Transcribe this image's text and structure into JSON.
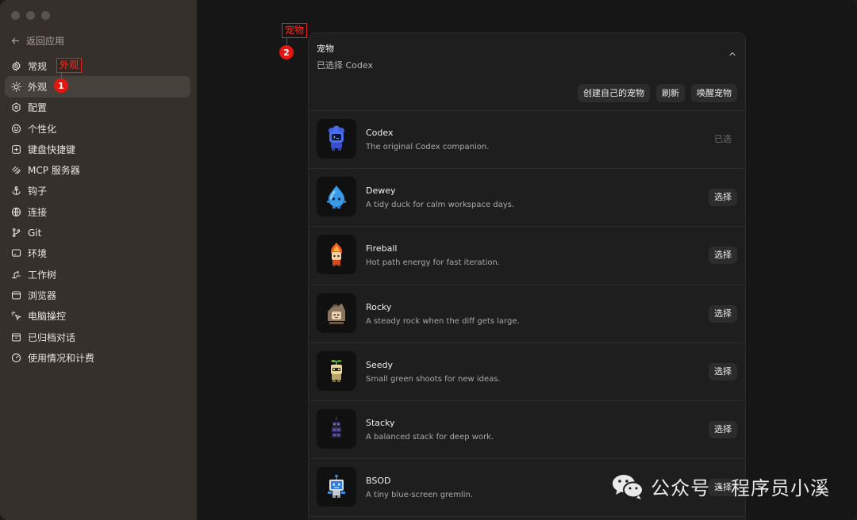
{
  "sidebar": {
    "back_label": "返回应用",
    "items": [
      {
        "label": "常规",
        "icon": "gear-icon"
      },
      {
        "label": "外观",
        "icon": "sun-icon",
        "active": true
      },
      {
        "label": "配置",
        "icon": "config-icon"
      },
      {
        "label": "个性化",
        "icon": "smile-icon"
      },
      {
        "label": "键盘快捷键",
        "icon": "keyboard-icon"
      },
      {
        "label": "MCP 服务器",
        "icon": "mcp-icon"
      },
      {
        "label": "钩子",
        "icon": "anchor-icon"
      },
      {
        "label": "连接",
        "icon": "globe-icon"
      },
      {
        "label": "Git",
        "icon": "git-branch-icon"
      },
      {
        "label": "环境",
        "icon": "monitor-icon"
      },
      {
        "label": "工作树",
        "icon": "worktree-icon"
      },
      {
        "label": "浏览器",
        "icon": "browser-icon"
      },
      {
        "label": "电脑操控",
        "icon": "cursor-click-icon"
      },
      {
        "label": "已归档对话",
        "icon": "archive-icon"
      },
      {
        "label": "使用情况和计费",
        "icon": "gauge-icon"
      }
    ]
  },
  "annotations": [
    {
      "label": "外观",
      "number": "1"
    },
    {
      "label": "宠物",
      "number": "2"
    }
  ],
  "pets_section": {
    "title": "宠物",
    "subtitle": "已选择 Codex",
    "actions": [
      "创建自己的宠物",
      "刷新",
      "唤醒宠物"
    ],
    "pets": [
      {
        "name": "Codex",
        "desc": "The original Codex companion.",
        "button": "已选",
        "selected": true,
        "color": "#3d5fe0"
      },
      {
        "name": "Dewey",
        "desc": "A tidy duck for calm workspace days.",
        "button": "选择",
        "selected": false,
        "color": "#3a9be8"
      },
      {
        "name": "Fireball",
        "desc": "Hot path energy for fast iteration.",
        "button": "选择",
        "selected": false,
        "color": "#f07a26"
      },
      {
        "name": "Rocky",
        "desc": "A steady rock when the diff gets large.",
        "button": "选择",
        "selected": false,
        "color": "#8a7560"
      },
      {
        "name": "Seedy",
        "desc": "Small green shoots for new ideas.",
        "button": "选择",
        "selected": false,
        "color": "#d8c58a"
      },
      {
        "name": "Stacky",
        "desc": "A balanced stack for deep work.",
        "button": "选择",
        "selected": false,
        "color": "#3f3a6a"
      },
      {
        "name": "BSOD",
        "desc": "A tiny blue-screen gremlin.",
        "button": "选择",
        "selected": false,
        "color": "#3b8ee8"
      }
    ]
  },
  "watermark": "公众号 · 程序员小溪"
}
